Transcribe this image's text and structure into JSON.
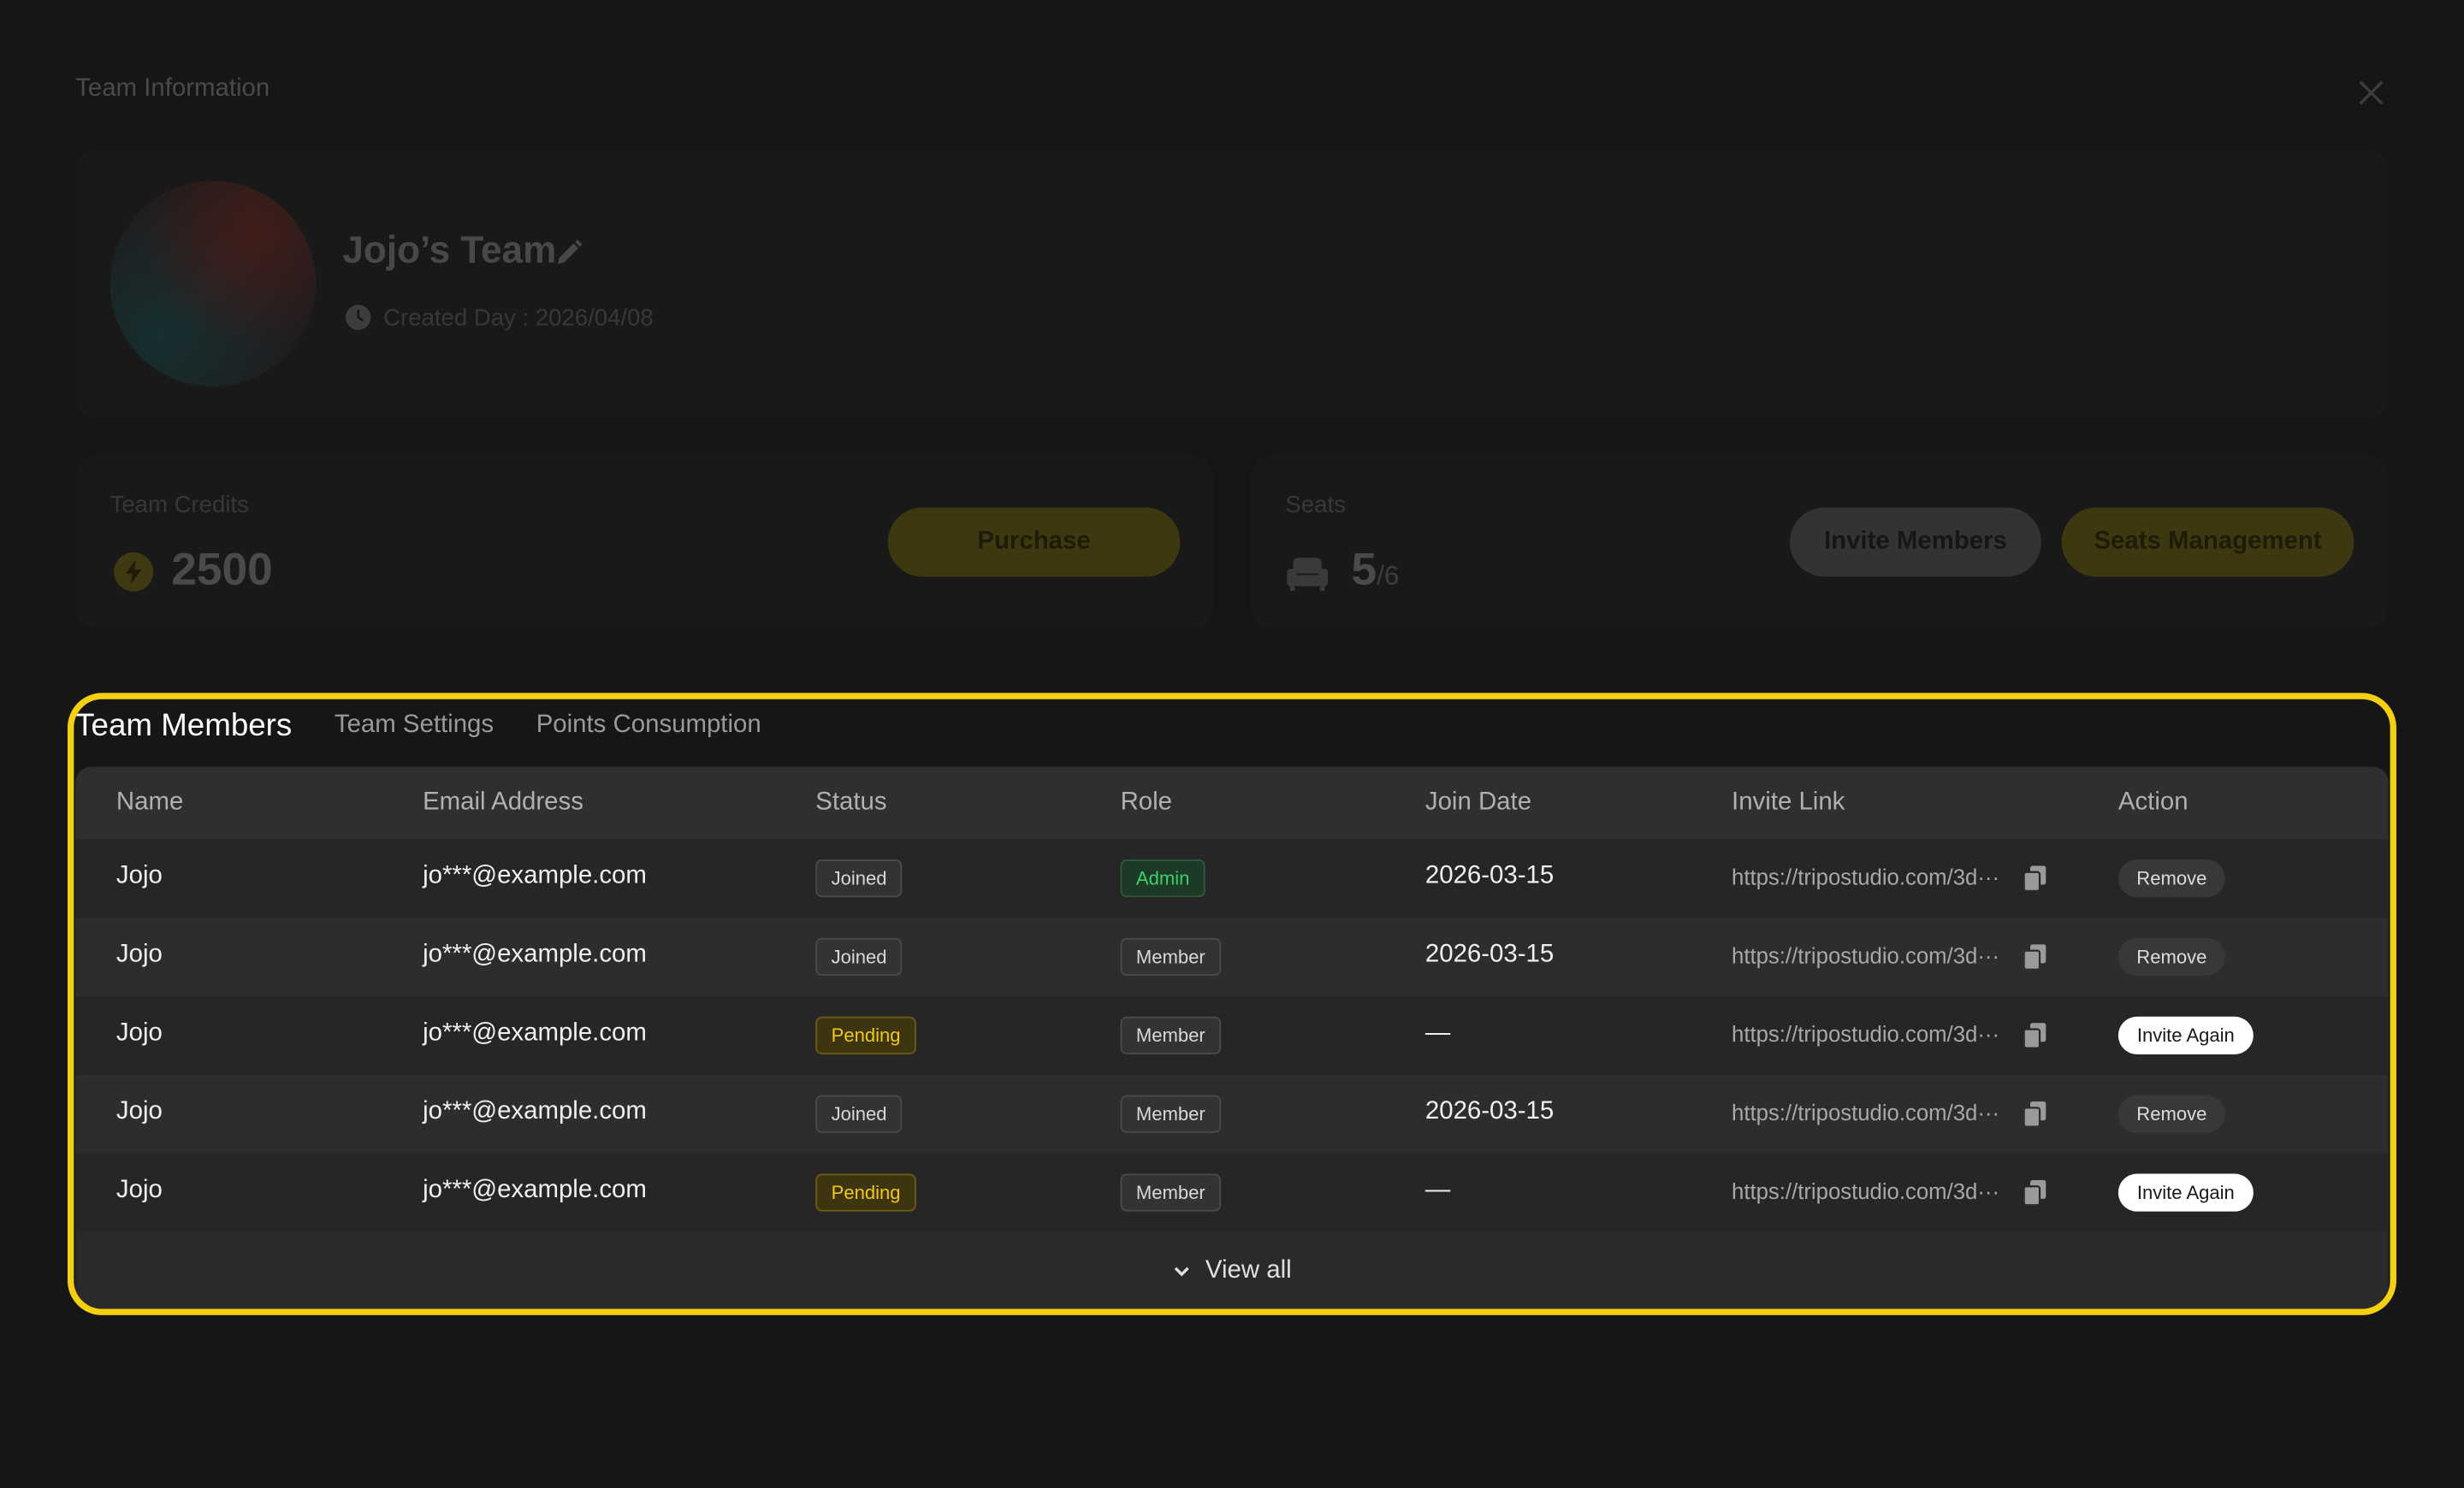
{
  "modal": {
    "title": "Team Information"
  },
  "team": {
    "name": "Jojo’s Team",
    "created": "Created Day : 2026/04/08"
  },
  "credits": {
    "label": "Team Credits",
    "value": "2500",
    "purchase_label": "Purchase"
  },
  "seats": {
    "label": "Seats",
    "used": "5",
    "total": "/6",
    "invite_label": "Invite Members",
    "manage_label": "Seats Management"
  },
  "tabs": [
    {
      "label": "Team Members"
    },
    {
      "label": "Team Settings"
    },
    {
      "label": "Points Consumption"
    }
  ],
  "table": {
    "headers": [
      "Name",
      "Email Address",
      "Status",
      "Role",
      "Join Date",
      "Invite Link",
      "Action"
    ],
    "rows": [
      {
        "name": "Jojo",
        "email": "jo***@example.com",
        "status": "Joined",
        "role": "Admin",
        "date": "2026-03-15",
        "link": "https://tripostudio.com/3d···",
        "action": "Remove"
      },
      {
        "name": "Jojo",
        "email": "jo***@example.com",
        "status": "Joined",
        "role": "Member",
        "date": "2026-03-15",
        "link": "https://tripostudio.com/3d···",
        "action": "Remove"
      },
      {
        "name": "Jojo",
        "email": "jo***@example.com",
        "status": "Pending",
        "role": "Member",
        "date": "—",
        "link": "https://tripostudio.com/3d···",
        "action": "Invite Again"
      },
      {
        "name": "Jojo",
        "email": "jo***@example.com",
        "status": "Joined",
        "role": "Member",
        "date": "2026-03-15",
        "link": "https://tripostudio.com/3d···",
        "action": "Remove"
      },
      {
        "name": "Jojo",
        "email": "jo***@example.com",
        "status": "Pending",
        "role": "Member",
        "date": "—",
        "link": "https://tripostudio.com/3d···",
        "action": "Invite Again"
      }
    ],
    "view_all": "View all"
  },
  "colors": {
    "highlight": "#f5cf12",
    "pending": "#f2c81a",
    "admin": "#3ecf6a"
  }
}
